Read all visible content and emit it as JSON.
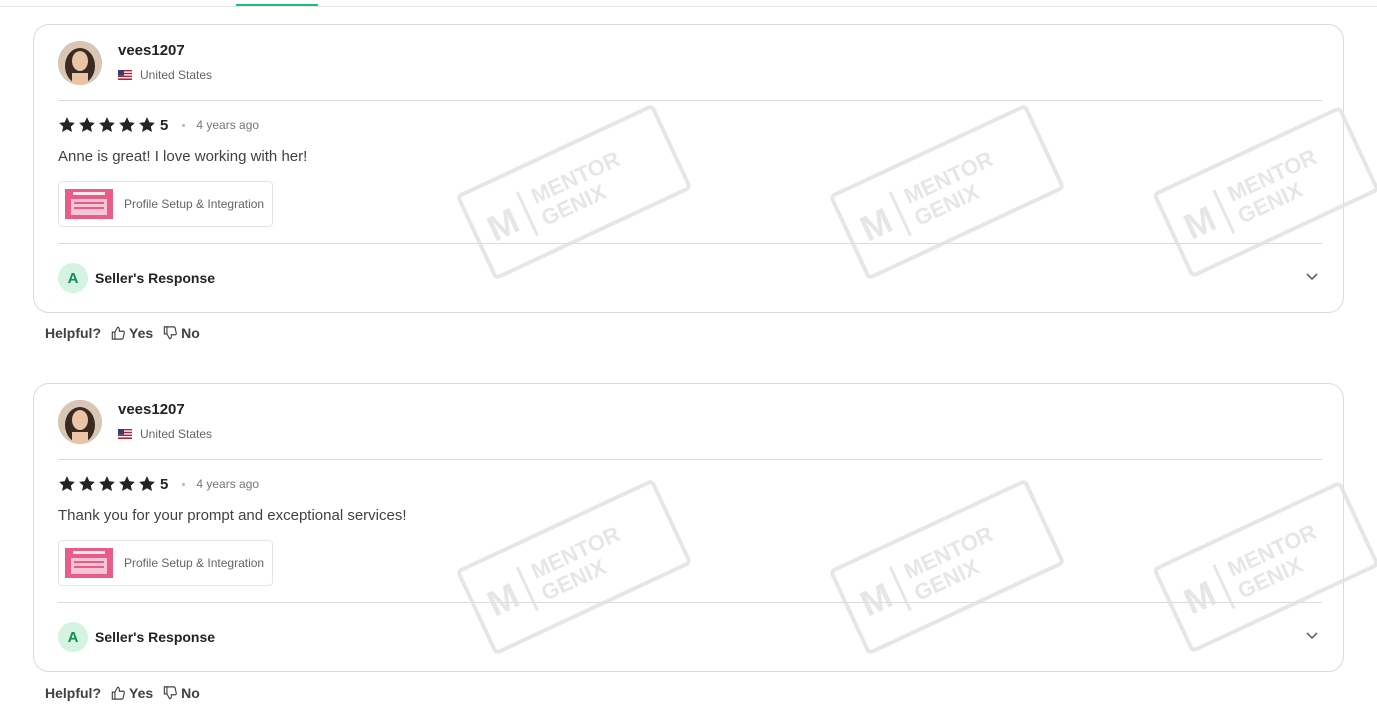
{
  "reviews": [
    {
      "username": "vees1207",
      "country": "United States",
      "rating": "5",
      "stars": 5,
      "time": "4 years ago",
      "text": "Anne is great! I love working with her!",
      "gig_label": "Profile Setup & Integration",
      "seller_badge": "A",
      "seller_response_label": "Seller's Response"
    },
    {
      "username": "vees1207",
      "country": "United States",
      "rating": "5",
      "stars": 5,
      "time": "4 years ago",
      "text": "Thank you for your prompt and exceptional services!",
      "gig_label": "Profile Setup & Integration",
      "seller_badge": "A",
      "seller_response_label": "Seller's Response"
    }
  ],
  "helpful": {
    "label": "Helpful?",
    "yes": "Yes",
    "no": "No"
  },
  "watermark": {
    "line1": "MENTOR",
    "line2": "GENIX",
    "mark": "M"
  },
  "colors": {
    "accent": "#1dbf73",
    "seller_badge_bg": "#d4f3e1",
    "seller_badge_text": "#0e8f4e",
    "gig_thumb": "#e95c88"
  }
}
